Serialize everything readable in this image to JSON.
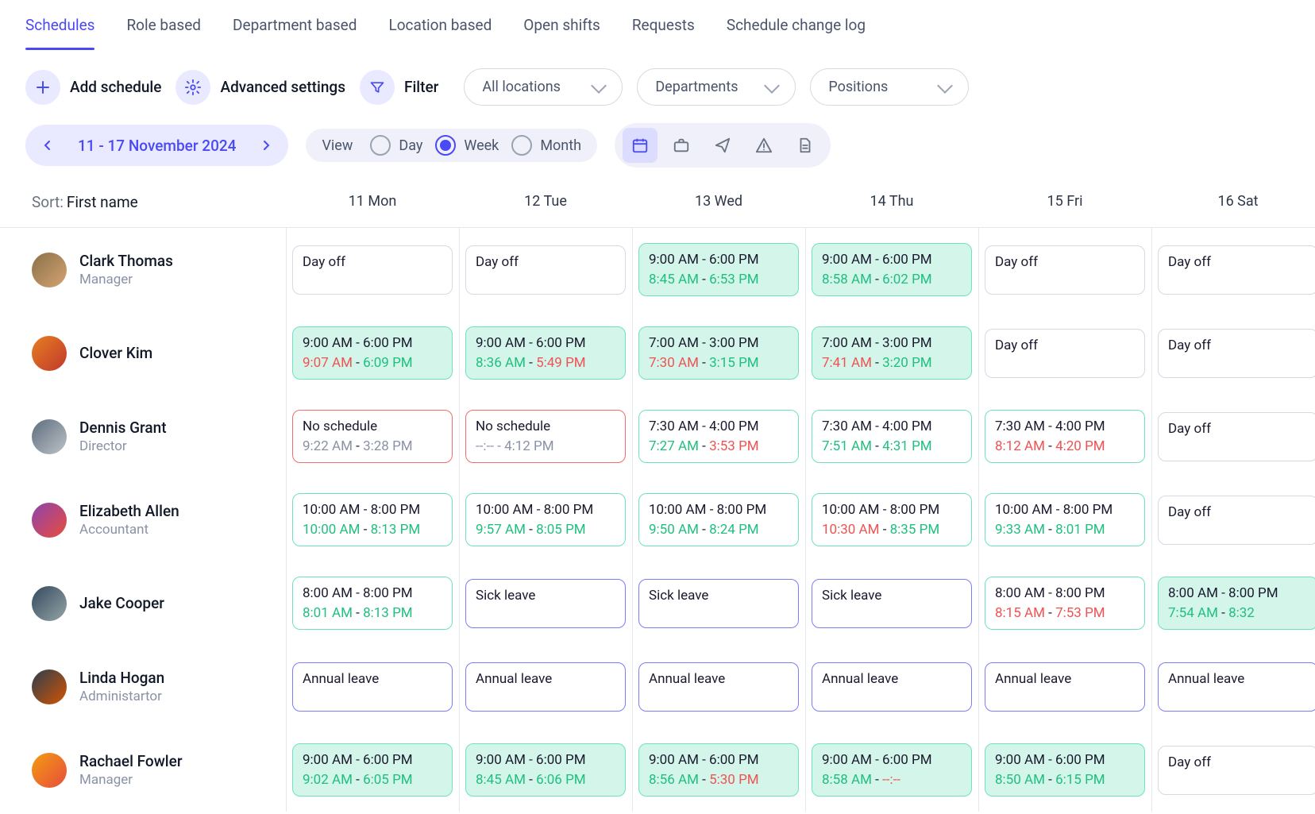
{
  "tabs": [
    "Schedules",
    "Role based",
    "Department based",
    "Location based",
    "Open shifts",
    "Requests",
    "Schedule change log"
  ],
  "active_tab": 0,
  "toolbar": {
    "add_label": "Add schedule",
    "advanced_label": "Advanced settings",
    "filter_label": "Filter",
    "selects": {
      "locations": "All locations",
      "departments": "Departments",
      "positions": "Positions"
    }
  },
  "date_nav": {
    "range": "11 - 17 November 2024"
  },
  "view": {
    "label": "View",
    "options": [
      "Day",
      "Week",
      "Month"
    ],
    "active": 1
  },
  "sort": {
    "label": "Sort:",
    "value": "First name"
  },
  "days": [
    "11 Mon",
    "12 Tue",
    "13 Wed",
    "14 Thu",
    "15 Fri",
    "16 Sat"
  ],
  "employees": [
    {
      "name": "Clark Thomas",
      "role": "Manager",
      "avatar": "a1",
      "cells": [
        {
          "kind": "grey",
          "title": "Day off"
        },
        {
          "kind": "grey",
          "title": "Day off"
        },
        {
          "kind": "tealf",
          "title": "9:00 AM - 6:00 PM",
          "t1": "8:45 AM",
          "c1": "t-green",
          "t2": "6:53 PM",
          "c2": "t-green"
        },
        {
          "kind": "tealf",
          "title": "9:00 AM - 6:00 PM",
          "t1": "8:58 AM",
          "c1": "t-green",
          "t2": "6:02 PM",
          "c2": "t-green"
        },
        {
          "kind": "grey",
          "title": "Day off"
        },
        {
          "kind": "grey",
          "title": "Day off"
        }
      ]
    },
    {
      "name": "Clover Kim",
      "role": "",
      "avatar": "a2",
      "cells": [
        {
          "kind": "tealf",
          "title": "9:00 AM - 6:00 PM",
          "t1": "9:07 AM",
          "c1": "t-red",
          "t2": "6:09 PM",
          "c2": "t-green"
        },
        {
          "kind": "tealf",
          "title": "9:00 AM - 6:00 PM",
          "t1": "8:36 AM",
          "c1": "t-green",
          "t2": "5:49 PM",
          "c2": "t-red"
        },
        {
          "kind": "tealf",
          "title": "7:00 AM - 3:00 PM",
          "t1": "7:30 AM",
          "c1": "t-red",
          "t2": "3:15 PM",
          "c2": "t-green"
        },
        {
          "kind": "tealf",
          "title": "7:00 AM - 3:00 PM",
          "t1": "7:41 AM",
          "c1": "t-red",
          "t2": "3:20 PM",
          "c2": "t-green"
        },
        {
          "kind": "grey",
          "title": "Day off"
        },
        {
          "kind": "grey",
          "title": "Day off"
        }
      ]
    },
    {
      "name": "Dennis Grant",
      "role": "Director",
      "avatar": "a3",
      "cells": [
        {
          "kind": "red",
          "title": "No schedule",
          "t1": "9:22 AM",
          "c1": "t-grey",
          "t2": "3:28 PM",
          "c2": "t-grey"
        },
        {
          "kind": "red",
          "title": "No schedule",
          "t1": "--:--",
          "c1": "t-grey",
          "t2": "4:12 PM",
          "c2": "t-grey",
          "sepgrey": true
        },
        {
          "kind": "teal",
          "title": "7:30 AM - 4:00 PM",
          "t1": "7:27 AM",
          "c1": "t-green",
          "t2": "3:53 PM",
          "c2": "t-red"
        },
        {
          "kind": "teal",
          "title": "7:30 AM - 4:00 PM",
          "t1": "7:51 AM",
          "c1": "t-green",
          "t2": "4:31 PM",
          "c2": "t-green"
        },
        {
          "kind": "teal",
          "title": "7:30 AM - 4:00 PM",
          "t1": "8:12 AM",
          "c1": "t-red",
          "t2": "4:20 PM",
          "c2": "t-red"
        },
        {
          "kind": "grey",
          "title": "Day off"
        }
      ]
    },
    {
      "name": "Elizabeth Allen",
      "role": "Accountant",
      "avatar": "a4",
      "cells": [
        {
          "kind": "teal",
          "title": "10:00 AM - 8:00 PM",
          "t1": "10:00 AM",
          "c1": "t-green",
          "t2": "8:13 PM",
          "c2": "t-green"
        },
        {
          "kind": "teal",
          "title": "10:00 AM - 8:00 PM",
          "t1": "9:57 AM",
          "c1": "t-green",
          "t2": "8:05 PM",
          "c2": "t-green"
        },
        {
          "kind": "teal",
          "title": "10:00 AM - 8:00 PM",
          "t1": "9:50 AM",
          "c1": "t-green",
          "t2": "8:24 PM",
          "c2": "t-green"
        },
        {
          "kind": "teal",
          "title": "10:00 AM - 8:00 PM",
          "t1": "10:30 AM",
          "c1": "t-red",
          "t2": "8:35 PM",
          "c2": "t-green"
        },
        {
          "kind": "teal",
          "title": "10:00 AM - 8:00 PM",
          "t1": "9:33 AM",
          "c1": "t-green",
          "t2": "8:01 PM",
          "c2": "t-green"
        },
        {
          "kind": "grey",
          "title": "Day off"
        }
      ]
    },
    {
      "name": "Jake Cooper",
      "role": "",
      "avatar": "a5",
      "cells": [
        {
          "kind": "teal",
          "title": "8:00 AM - 8:00 PM",
          "t1": "8:01 AM",
          "c1": "t-green",
          "t2": "8:13 PM",
          "c2": "t-green"
        },
        {
          "kind": "purple",
          "title": "Sick leave"
        },
        {
          "kind": "purple",
          "title": "Sick leave"
        },
        {
          "kind": "purple",
          "title": "Sick leave"
        },
        {
          "kind": "teal",
          "title": "8:00 AM - 8:00 PM",
          "t1": "8:15 AM",
          "c1": "t-red",
          "t2": "7:53 PM",
          "c2": "t-red"
        },
        {
          "kind": "tealf",
          "title": "8:00 AM - 8:00 PM",
          "t1": "7:54 AM",
          "c1": "t-green",
          "t2": "8:32",
          "c2": "t-green",
          "clip": true
        }
      ]
    },
    {
      "name": "Linda Hogan",
      "role": "Administartor",
      "avatar": "a6",
      "cells": [
        {
          "kind": "purple",
          "title": "Annual leave"
        },
        {
          "kind": "purple",
          "title": "Annual leave"
        },
        {
          "kind": "purple",
          "title": "Annual leave"
        },
        {
          "kind": "purple",
          "title": "Annual leave"
        },
        {
          "kind": "purple",
          "title": "Annual leave"
        },
        {
          "kind": "purple",
          "title": "Annual leave"
        }
      ]
    },
    {
      "name": "Rachael Fowler",
      "role": "Manager",
      "avatar": "a7",
      "cells": [
        {
          "kind": "tealf",
          "title": "9:00 AM - 6:00 PM",
          "t1": "9:02 AM",
          "c1": "t-green",
          "t2": "6:05 PM",
          "c2": "t-green"
        },
        {
          "kind": "tealf",
          "title": "9:00 AM - 6:00 PM",
          "t1": "8:45 AM",
          "c1": "t-green",
          "t2": "6:06 PM",
          "c2": "t-green"
        },
        {
          "kind": "tealf",
          "title": "9:00 AM - 6:00 PM",
          "t1": "8:56 AM",
          "c1": "t-green",
          "t2": "5:30 PM",
          "c2": "t-red"
        },
        {
          "kind": "tealf",
          "title": "9:00 AM - 6:00 PM",
          "t1": "8:58 AM",
          "c1": "t-green",
          "t2": "--:--",
          "c2": "t-red"
        },
        {
          "kind": "tealf",
          "title": "9:00 AM - 6:00 PM",
          "t1": "8:50 AM",
          "c1": "t-green",
          "t2": "6:15 PM",
          "c2": "t-green"
        },
        {
          "kind": "grey",
          "title": "Day off"
        }
      ]
    }
  ]
}
